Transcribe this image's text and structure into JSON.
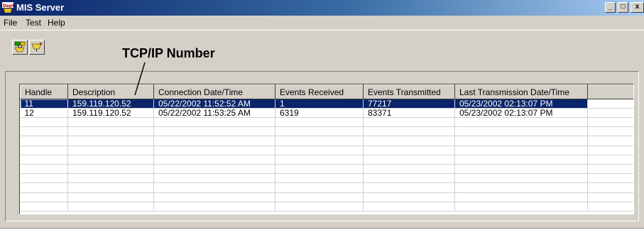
{
  "window": {
    "title": "MIS Server",
    "minimize": "_",
    "maximize": "□",
    "close": "x"
  },
  "menu": [
    "File",
    "Test",
    "Help"
  ],
  "toolbar": {
    "buttons": [
      {
        "icon": "network-connect-icon"
      },
      {
        "icon": "network-disconnect-icon"
      }
    ]
  },
  "annotation": {
    "text": "TCP/IP Number"
  },
  "table": {
    "columns": [
      "Handle",
      "Description",
      "Connection Date/Time",
      "Events Received",
      "Events Transmitted",
      "Last Transmission Date/Time",
      ""
    ],
    "rows": [
      {
        "handle": "11",
        "description": "159.119.120.52",
        "connection": "05/22/2002 11:52:52 AM",
        "received": "1",
        "transmitted": "77217",
        "last": "05/23/2002 02:13:07 PM",
        "selected": true
      },
      {
        "handle": "12",
        "description": "159.119.120.52",
        "connection": "05/22/2002 11:53:25 AM",
        "received": "6319",
        "transmitted": "83371",
        "last": "05/23/2002 02:13:07 PM",
        "selected": false
      }
    ]
  },
  "colors": {
    "title_start": "#0a246a",
    "title_end": "#a6caf0",
    "selection": "#0a246a",
    "chrome": "#d4d0c8"
  }
}
